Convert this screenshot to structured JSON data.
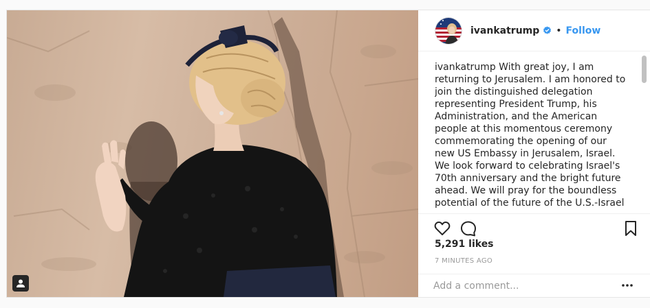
{
  "header": {
    "username": "ivankatrump",
    "separator": "•",
    "follow_label": "Follow",
    "verified_color": "#3897f0"
  },
  "caption": {
    "username": "ivankatrump",
    "text": " With great joy, I am returning to Jerusalem. I am honored to join the distinguished delegation representing President Trump, his Administration, and the American people at this momentous ceremony commemorating the opening of our new US Embassy in Jerusalem, Israel. We look forward to celebrating Israel's 70th anniversary and the bright future ahead. We will pray for the boundless potential of the future of the U.S.-Israel"
  },
  "actions": {
    "like_icon": "heart-icon",
    "comment_icon": "comment-icon",
    "save_icon": "bookmark-icon"
  },
  "stats": {
    "likes": "5,291 likes",
    "posted": "7 MINUTES AGO"
  },
  "comment": {
    "placeholder": "Add a comment..."
  },
  "media": {
    "tag_icon": "user-tag-icon"
  },
  "colors": {
    "link": "#3897f0",
    "text": "#262626",
    "muted": "#999999"
  }
}
